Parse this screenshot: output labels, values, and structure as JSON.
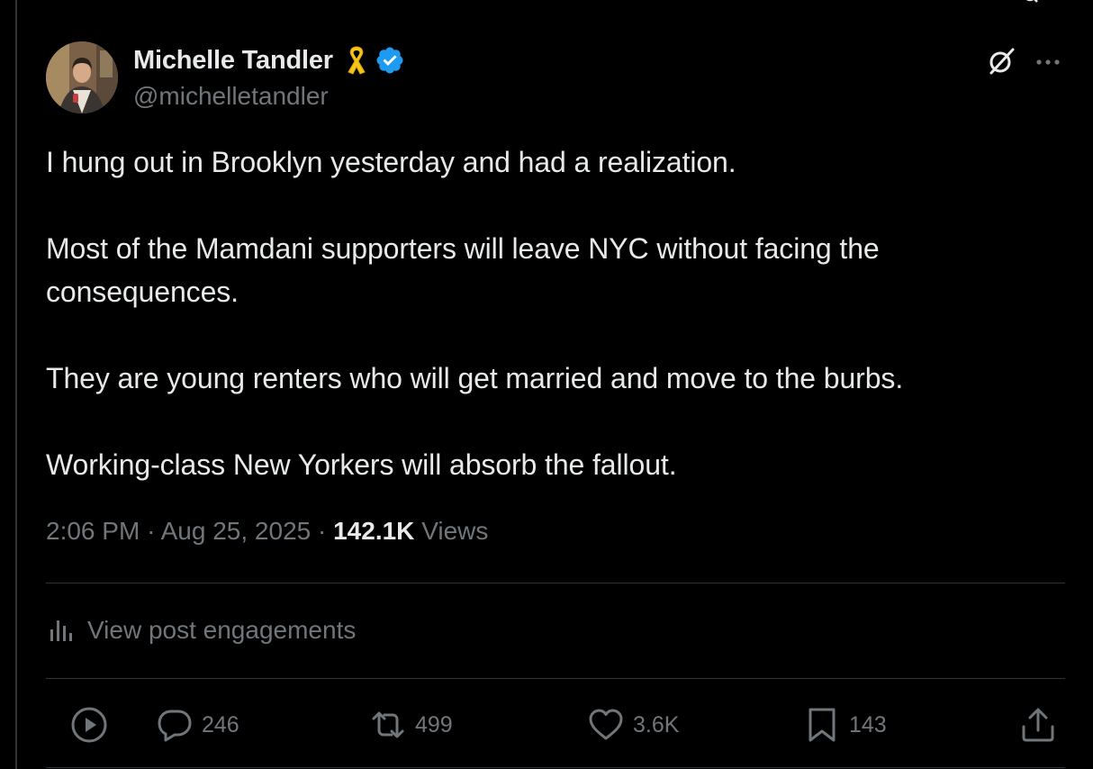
{
  "post": {
    "author": {
      "display_name": "Michelle Tandler",
      "handle": "@michelletandler",
      "badges": [
        "yellow-ribbon-icon",
        "verified-badge-icon"
      ]
    },
    "text": {
      "p1": "I hung out in Brooklyn yesterday and had a realization.",
      "p2": "Most of the Mamdani supporters will leave NYC without facing the consequences.",
      "p3": "They are young renters who will get married and move to the burbs.",
      "p4": "Working-class New Yorkers will absorb the fallout."
    },
    "meta": {
      "time": "2:06 PM",
      "date": "Aug 25, 2025",
      "separator": "·",
      "views_count": "142.1K",
      "views_label": "Views"
    },
    "engagements_label": "View post engagements",
    "actions": {
      "play": "play-icon",
      "replies": "246",
      "reposts": "499",
      "likes": "3.6K",
      "bookmarks": "143",
      "share": "share-icon"
    }
  },
  "colors": {
    "background": "#000000",
    "text_primary": "#e7e9ea",
    "text_secondary": "#71767b",
    "divider": "#2f3336",
    "verified_blue": "#1d9bf0",
    "ribbon_yellow": "#f5c518"
  }
}
